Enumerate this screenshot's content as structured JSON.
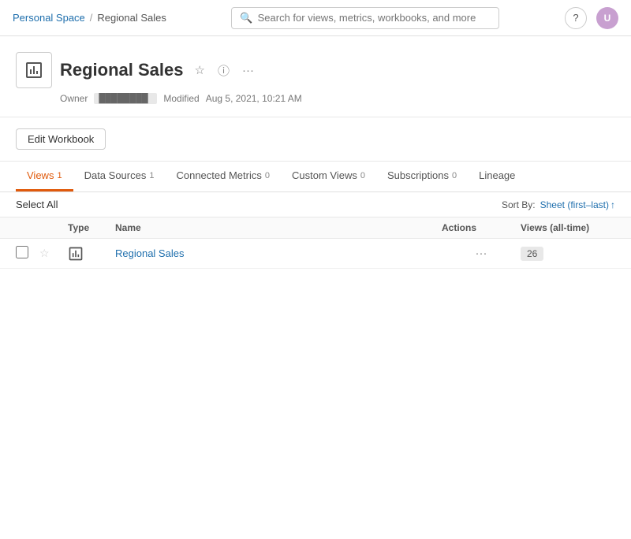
{
  "nav": {
    "breadcrumb": {
      "personal": "Personal Space",
      "separator": "/",
      "current": "Regional Sales"
    },
    "search_placeholder": "Search for views, metrics, workbooks, and more",
    "help_icon": "?",
    "avatar_initials": "U"
  },
  "workbook": {
    "title": "Regional Sales",
    "icon_char": "▪",
    "owner_label": "Owner",
    "owner_value": "████████",
    "modified_label": "Modified",
    "modified_date": "Aug 5, 2021, 10:21 AM"
  },
  "toolbar": {
    "edit_btn_label": "Edit Workbook"
  },
  "tabs": [
    {
      "id": "views",
      "label": "Views",
      "count": "1",
      "active": true
    },
    {
      "id": "sources",
      "label": "Data Sources",
      "count": "1",
      "active": false
    },
    {
      "id": "metrics",
      "label": "Connected Metrics",
      "count": "0",
      "active": false
    },
    {
      "id": "custom",
      "label": "Custom Views",
      "count": "0",
      "active": false
    },
    {
      "id": "subs",
      "label": "Subscriptions",
      "count": "0",
      "active": false
    },
    {
      "id": "lineage",
      "label": "Lineage",
      "count": "",
      "active": false
    }
  ],
  "table_toolbar": {
    "select_all_label": "Select All",
    "sort_by_label": "Sort By:",
    "sort_value": "Sheet (first–last)",
    "sort_arrow": "↑"
  },
  "table": {
    "columns": [
      "",
      "",
      "Type",
      "Name",
      "Actions",
      "Views (all-time)"
    ],
    "rows": [
      {
        "name": "Regional Sales",
        "type_icon": "▪",
        "views_count": "26"
      }
    ]
  }
}
